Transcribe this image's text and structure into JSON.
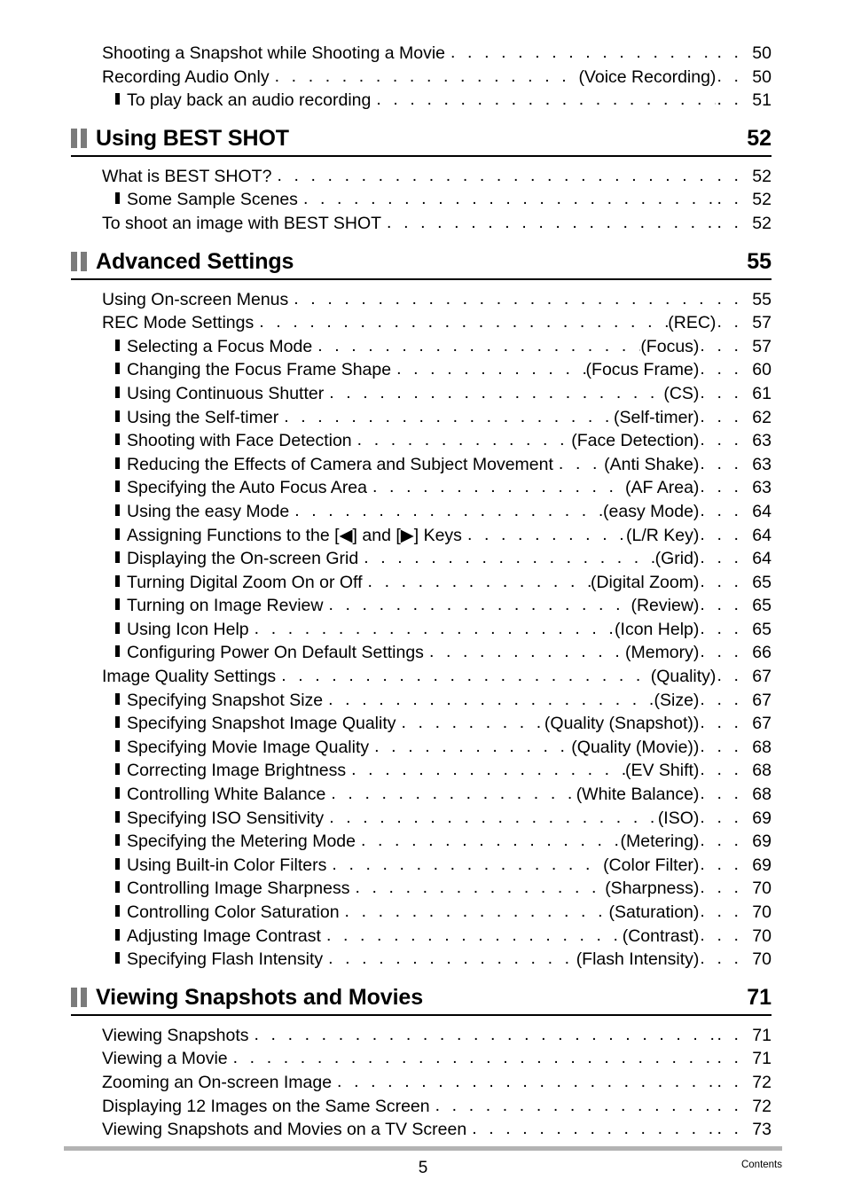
{
  "document": {
    "footer_page_number": "5",
    "footer_label": "Contents"
  },
  "blocks": [
    {
      "type": "entries",
      "entries": [
        {
          "level": 1,
          "label": "Shooting a Snapshot while Shooting a Movie",
          "qualifier": "",
          "page": "50"
        },
        {
          "level": 1,
          "label": "Recording Audio Only",
          "qualifier": "(Voice Recording)",
          "page": "50"
        },
        {
          "level": 2,
          "label": "To play back an audio recording",
          "qualifier": "",
          "page": "51"
        }
      ]
    },
    {
      "type": "section",
      "title": "Using BEST SHOT",
      "page": "52",
      "entries": [
        {
          "level": 1,
          "label": "What is BEST SHOT?",
          "qualifier": "",
          "page": "52"
        },
        {
          "level": 2,
          "label": "Some Sample Scenes",
          "qualifier": "",
          "page": "52"
        },
        {
          "level": 1,
          "label": "To shoot an image with BEST SHOT",
          "qualifier": "",
          "page": "52"
        }
      ]
    },
    {
      "type": "section",
      "title": "Advanced Settings",
      "page": "55",
      "entries": [
        {
          "level": 1,
          "label": "Using On-screen Menus",
          "qualifier": "",
          "page": "55"
        },
        {
          "level": 1,
          "label": "REC Mode Settings",
          "qualifier": "(REC)",
          "page": "57"
        },
        {
          "level": 2,
          "label": "Selecting a Focus Mode",
          "qualifier": "(Focus)",
          "page": "57"
        },
        {
          "level": 2,
          "label": "Changing the Focus Frame Shape",
          "qualifier": "(Focus Frame)",
          "page": "60"
        },
        {
          "level": 2,
          "label": "Using Continuous Shutter",
          "qualifier": "(CS)",
          "page": "61"
        },
        {
          "level": 2,
          "label": "Using the Self-timer",
          "qualifier": "(Self-timer)",
          "page": "62"
        },
        {
          "level": 2,
          "label": "Shooting with Face Detection",
          "qualifier": "(Face Detection)",
          "page": "63"
        },
        {
          "level": 2,
          "label": "Reducing the Effects of Camera and Subject Movement",
          "qualifier": "(Anti Shake)",
          "page": "63"
        },
        {
          "level": 2,
          "label": "Specifying the Auto Focus Area",
          "qualifier": "(AF Area)",
          "page": "63"
        },
        {
          "level": 2,
          "label": "Using the easy Mode",
          "qualifier": "(easy Mode)",
          "page": "64"
        },
        {
          "level": 2,
          "label": "Assigning Functions to the [◀] and [▶] Keys",
          "qualifier": "(L/R Key)",
          "page": "64"
        },
        {
          "level": 2,
          "label": "Displaying the On-screen Grid",
          "qualifier": "(Grid)",
          "page": "64"
        },
        {
          "level": 2,
          "label": "Turning Digital Zoom On or Off",
          "qualifier": "(Digital Zoom)",
          "page": "65"
        },
        {
          "level": 2,
          "label": "Turning on Image Review",
          "qualifier": "(Review)",
          "page": "65"
        },
        {
          "level": 2,
          "label": "Using Icon Help",
          "qualifier": "(Icon Help)",
          "page": "65"
        },
        {
          "level": 2,
          "label": "Configuring Power On Default Settings",
          "qualifier": "(Memory)",
          "page": "66"
        },
        {
          "level": 1,
          "label": "Image Quality Settings",
          "qualifier": "(Quality)",
          "page": "67"
        },
        {
          "level": 2,
          "label": "Specifying Snapshot Size",
          "qualifier": "(Size)",
          "page": "67"
        },
        {
          "level": 2,
          "label": "Specifying Snapshot Image Quality",
          "qualifier": "(Quality (Snapshot))",
          "page": "67"
        },
        {
          "level": 2,
          "label": "Specifying Movie Image Quality",
          "qualifier": "(Quality (Movie))",
          "page": "68"
        },
        {
          "level": 2,
          "label": "Correcting Image Brightness",
          "qualifier": "(EV Shift)",
          "page": "68"
        },
        {
          "level": 2,
          "label": "Controlling White Balance",
          "qualifier": "(White Balance)",
          "page": "68"
        },
        {
          "level": 2,
          "label": "Specifying ISO Sensitivity",
          "qualifier": "(ISO)",
          "page": "69"
        },
        {
          "level": 2,
          "label": "Specifying the Metering Mode",
          "qualifier": "(Metering)",
          "page": "69"
        },
        {
          "level": 2,
          "label": "Using Built-in Color Filters",
          "qualifier": "(Color Filter)",
          "page": "69"
        },
        {
          "level": 2,
          "label": "Controlling Image Sharpness",
          "qualifier": "(Sharpness)",
          "page": "70"
        },
        {
          "level": 2,
          "label": "Controlling Color Saturation",
          "qualifier": "(Saturation)",
          "page": "70"
        },
        {
          "level": 2,
          "label": "Adjusting Image Contrast",
          "qualifier": "(Contrast)",
          "page": "70"
        },
        {
          "level": 2,
          "label": "Specifying Flash Intensity",
          "qualifier": "(Flash Intensity)",
          "page": "70"
        }
      ]
    },
    {
      "type": "section",
      "title": "Viewing Snapshots and Movies",
      "page": "71",
      "entries": [
        {
          "level": 1,
          "label": "Viewing Snapshots",
          "qualifier": "",
          "page": "71"
        },
        {
          "level": 1,
          "label": "Viewing a Movie",
          "qualifier": "",
          "page": "71"
        },
        {
          "level": 1,
          "label": "Zooming an On-screen Image",
          "qualifier": "",
          "page": "72"
        },
        {
          "level": 1,
          "label": "Displaying 12 Images on the Same Screen",
          "qualifier": "",
          "page": "72"
        },
        {
          "level": 1,
          "label": "Viewing Snapshots and Movies on a TV Screen",
          "qualifier": "",
          "page": "73"
        }
      ]
    }
  ]
}
